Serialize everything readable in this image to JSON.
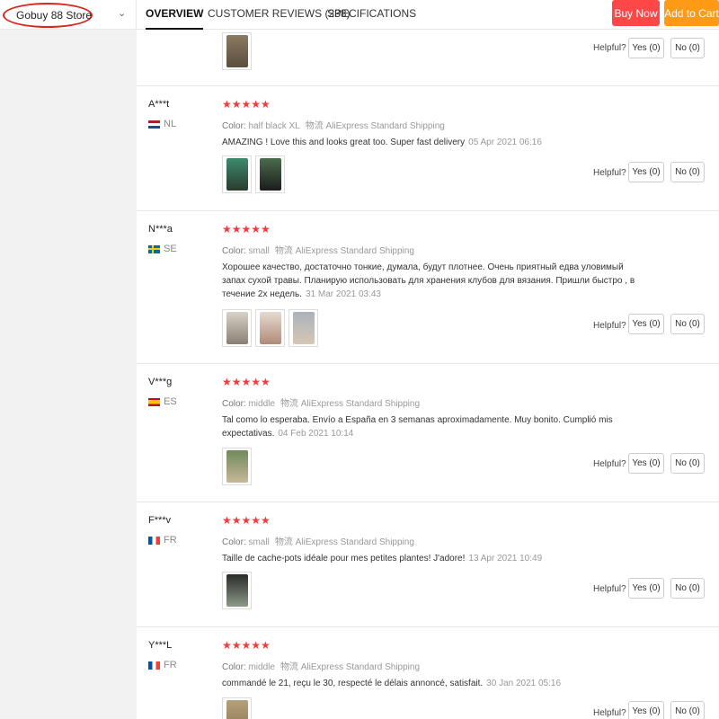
{
  "header": {
    "store_name": "Gobuy 88 Store",
    "tabs": [
      "OVERVIEW",
      "CUSTOMER REVIEWS (238)",
      "SPECIFICATIONS"
    ],
    "buy_now": "Buy Now",
    "add_to_cart": "Add to Cart"
  },
  "labels": {
    "color": "Color:",
    "shipping_icon": "物流",
    "shipping": "AliExpress Standard Shipping",
    "helpful": "Helpful?",
    "yes": "Yes (0)",
    "no": "No (0)",
    "stars": "★★★★★"
  },
  "reviews": [
    {
      "name": "A***t",
      "country": "NL",
      "color": "half black XL",
      "text": "AMAZING ! Love this and looks great too. Super fast delivery",
      "date": "05 Apr 2021 06:16"
    },
    {
      "name": "N***a",
      "country": "SE",
      "color": "small",
      "text": "Хорошее качество, достаточно тонкие, думала, будут плотнее. Очень приятный едва уловимый запах сухой травы. Планирую использовать для хранения клубов для вязания. Пришли быстро , в течение 2х недель.",
      "date": "31 Mar 2021 03:43"
    },
    {
      "name": "V***g",
      "country": "ES",
      "color": "middle",
      "text": "Tal como lo esperaba. Envío a España en 3 semanas aproximadamente. Muy bonito. Cumplió mis expectativas.",
      "date": "04 Feb 2021 10:14"
    },
    {
      "name": "F***v",
      "country": "FR",
      "color": "small",
      "text": "Taille de cache-pots idéale pour mes petites plantes! J'adore!",
      "date": "13 Apr 2021 10:49"
    },
    {
      "name": "Y***L",
      "country": "FR",
      "color": "middle",
      "text": "commandé le 21, reçu le 30, respecté le délais annoncé, satisfait.",
      "date": "30 Jan 2021 05:16"
    }
  ]
}
